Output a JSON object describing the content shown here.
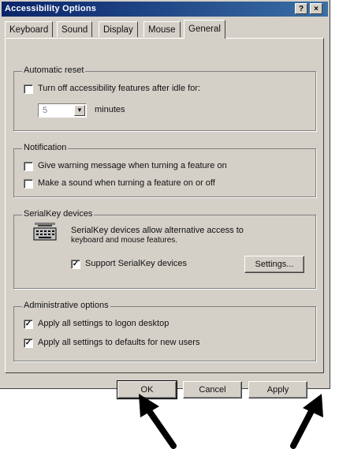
{
  "window": {
    "title": "Accessibility Options",
    "help_glyph": "?",
    "close_glyph": "×"
  },
  "tabs": [
    {
      "label": "Keyboard"
    },
    {
      "label": "Sound"
    },
    {
      "label": "Display"
    },
    {
      "label": "Mouse"
    },
    {
      "label": "General",
      "active": true
    }
  ],
  "automatic_reset": {
    "title": "Automatic reset",
    "checkbox_label": "Turn off accessibility features after idle for:",
    "checked": false,
    "minutes_value": "5",
    "minutes_label": "minutes"
  },
  "notification": {
    "title": "Notification",
    "items": [
      {
        "label": "Give warning message when turning a feature on",
        "checked": false
      },
      {
        "label": "Make a sound when turning a feature on or off",
        "checked": false
      }
    ]
  },
  "serialkey": {
    "title": "SerialKey devices",
    "description_line1": "SerialKey devices allow alternative access to",
    "description_line2": "keyboard and mouse features.",
    "checkbox_label": "Support SerialKey devices",
    "checked": true,
    "settings_button": "Settings..."
  },
  "administrative": {
    "title": "Administrative options",
    "items": [
      {
        "label": "Apply all settings to logon desktop",
        "checked": true
      },
      {
        "label": "Apply all settings to defaults for new users",
        "checked": true
      }
    ]
  },
  "footer": {
    "ok": "OK",
    "cancel": "Cancel",
    "apply": "Apply"
  },
  "icons": {
    "checkmark": "✓",
    "spin_down": "▼"
  }
}
